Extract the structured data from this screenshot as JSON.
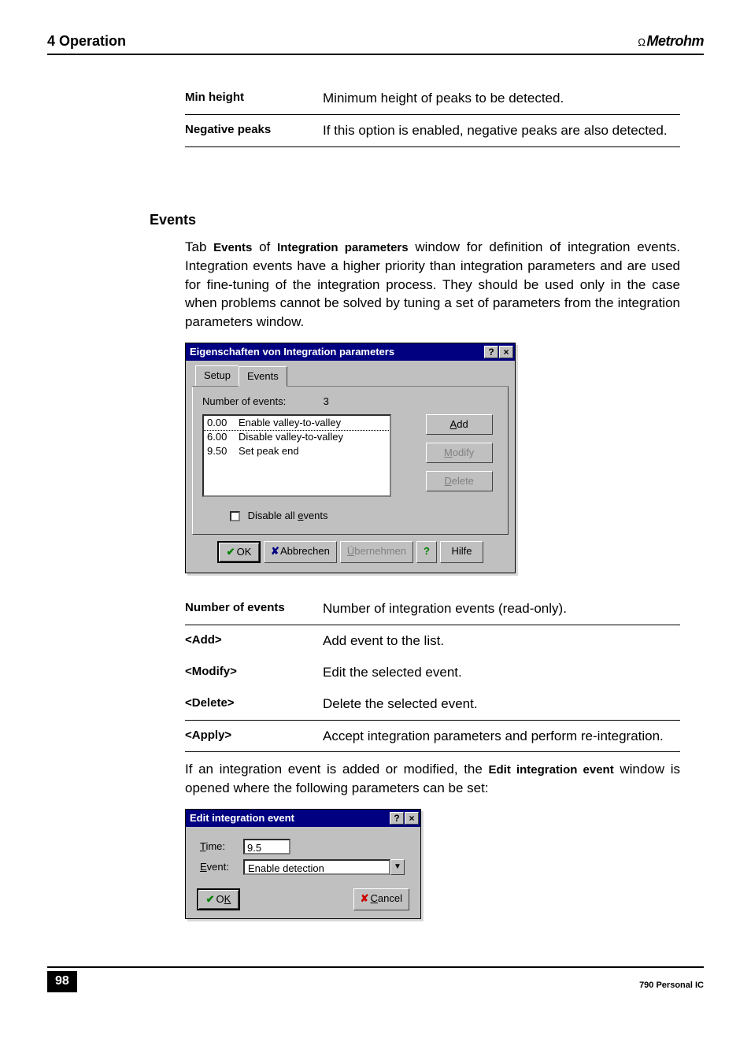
{
  "header": {
    "chapter": "4 Operation",
    "brand": "Metrohm"
  },
  "params_top": [
    {
      "label": "Min height",
      "desc": "Minimum height of peaks to be detected."
    },
    {
      "label": "Negative peaks",
      "desc": "If this option is enabled, negative peaks are also detected."
    }
  ],
  "events": {
    "heading": "Events",
    "intro_pre": "Tab ",
    "intro_b1": "Events",
    "intro_mid": " of ",
    "intro_b2": "Integration parameters",
    "intro_post": " window for definition of integration events. Integration events have a higher priority than integration parameters and are used for fine-tuning of the integration process. They should be used only in the case when problems cannot be solved by tuning a set of parameters from the integration parameters window."
  },
  "dialog1": {
    "title": "Eigenschaften von Integration parameters",
    "tabs": {
      "setup": "Setup",
      "events": "Events"
    },
    "num_events_label": "Number of events:",
    "num_events_value": "3",
    "list": [
      {
        "time": "0.00",
        "name": "Enable valley-to-valley"
      },
      {
        "time": "6.00",
        "name": "Disable valley-to-valley"
      },
      {
        "time": "9.50",
        "name": "Set peak end"
      }
    ],
    "buttons": {
      "add_u": "A",
      "add_rest": "dd",
      "modify_u": "M",
      "modify_rest": "odify",
      "delete_u": "D",
      "delete_rest": "elete"
    },
    "disable_all_pre": "Disable all ",
    "disable_all_u": "e",
    "disable_all_post": "vents",
    "bottom": {
      "ok": "OK",
      "cancel": "Abbrechen",
      "apply_u": "Ü",
      "apply_rest": "bernehmen",
      "help": "Hilfe"
    }
  },
  "params_bottom": [
    {
      "label": "Number of events",
      "desc": "Number of integration events (read-only)."
    },
    {
      "label": "<Add>",
      "desc": "Add event to the list."
    },
    {
      "label": "<Modify>",
      "desc": "Edit the selected event."
    },
    {
      "label": "<Delete>",
      "desc": "Delete the selected event."
    },
    {
      "label": "<Apply>",
      "desc": "Accept integration parameters and perform re-integration."
    }
  ],
  "note": {
    "pre": "If an integration event is added or modified, the ",
    "bold": "Edit integration event",
    "post": " window is opened where the following parameters can be set:"
  },
  "dialog2": {
    "title": "Edit integration event",
    "time_u": "T",
    "time_rest": "ime:",
    "time_value": "9.5",
    "event_u": "E",
    "event_rest": "vent:",
    "event_value": "Enable detection",
    "ok_u": "K",
    "ok_pre": "O",
    "cancel_u": "C",
    "cancel_rest": "ancel"
  },
  "footer": {
    "page": "98",
    "doc": "790 Personal IC"
  }
}
